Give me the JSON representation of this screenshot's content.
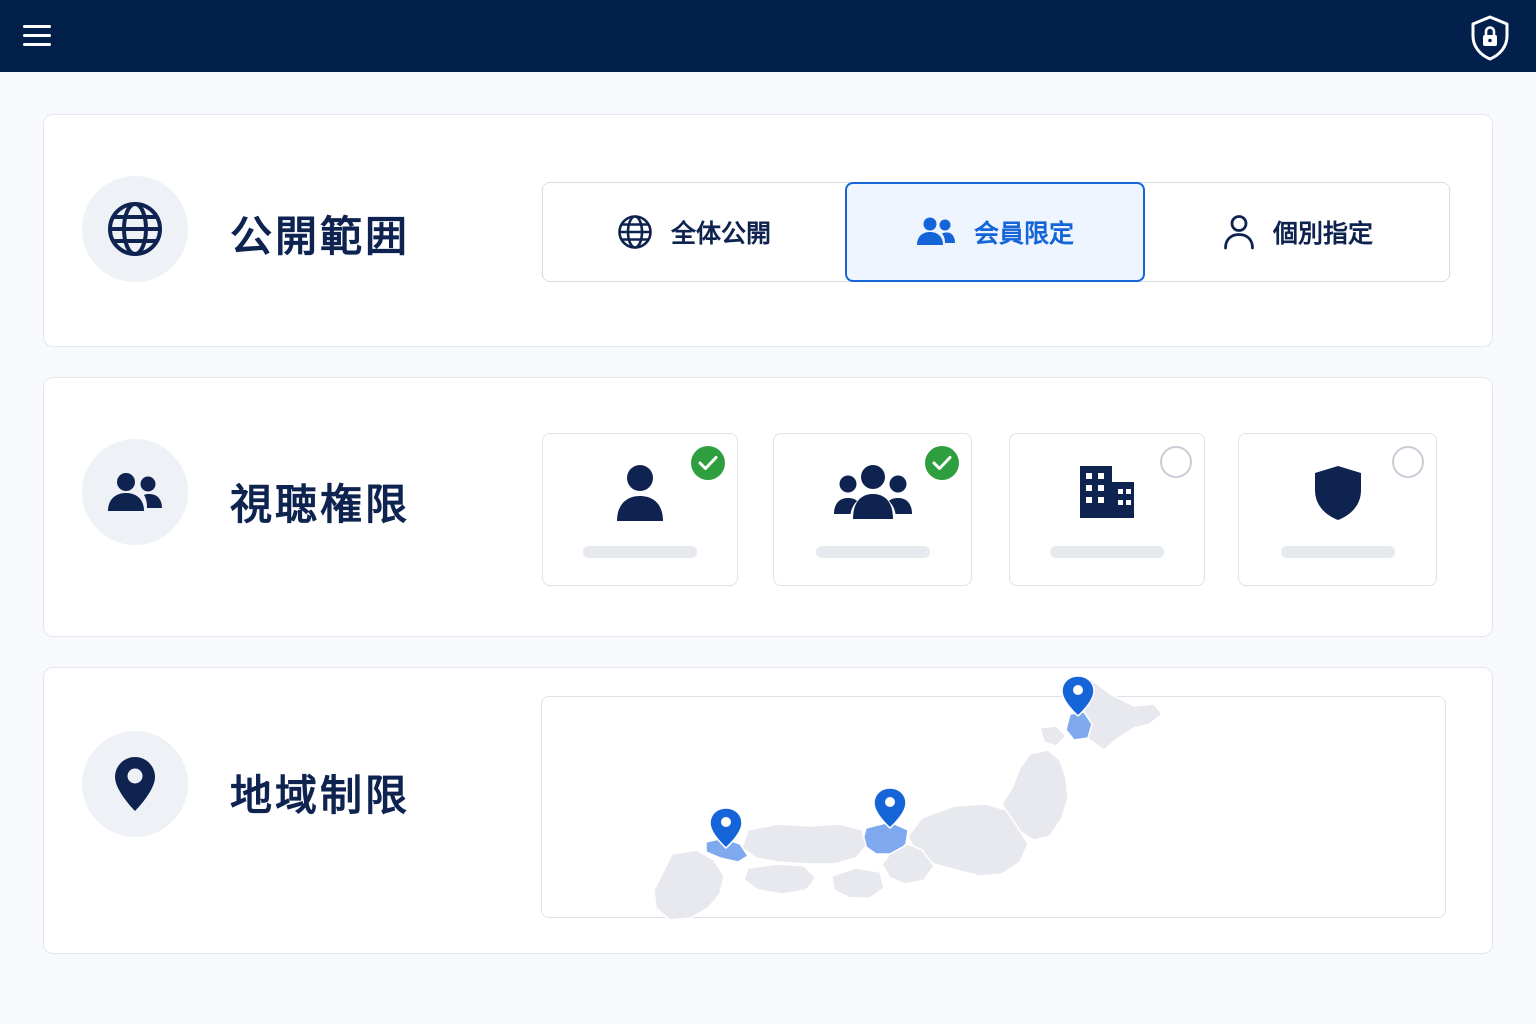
{
  "header": {
    "menu_icon": "hamburger-menu-icon",
    "security_icon": "shield-lock-icon"
  },
  "visibility": {
    "title": "公開範囲",
    "icon": "globe-icon",
    "options": [
      {
        "label": "全体公開",
        "icon": "globe-icon",
        "selected": false
      },
      {
        "label": "会員限定",
        "icon": "users-icon",
        "selected": true
      },
      {
        "label": "個別指定",
        "icon": "user-outline-icon",
        "selected": false
      }
    ]
  },
  "permissions": {
    "title": "視聴権限",
    "icon": "users-icon",
    "tiles": [
      {
        "icon": "user-icon",
        "checked": true
      },
      {
        "icon": "group-icon",
        "checked": true
      },
      {
        "icon": "building-icon",
        "checked": false
      },
      {
        "icon": "shield-icon",
        "checked": false
      }
    ]
  },
  "region": {
    "title": "地域制限",
    "icon": "map-pin-icon",
    "map_icon": "japan-map",
    "selected_regions": 3
  },
  "colors": {
    "header_bg": "#031f4b",
    "primary_text": "#0e2350",
    "accent": "#1565d8",
    "check_green": "#2e9e3e",
    "region_highlight": "#7fa9ee",
    "map_land": "#e7e9ee"
  }
}
